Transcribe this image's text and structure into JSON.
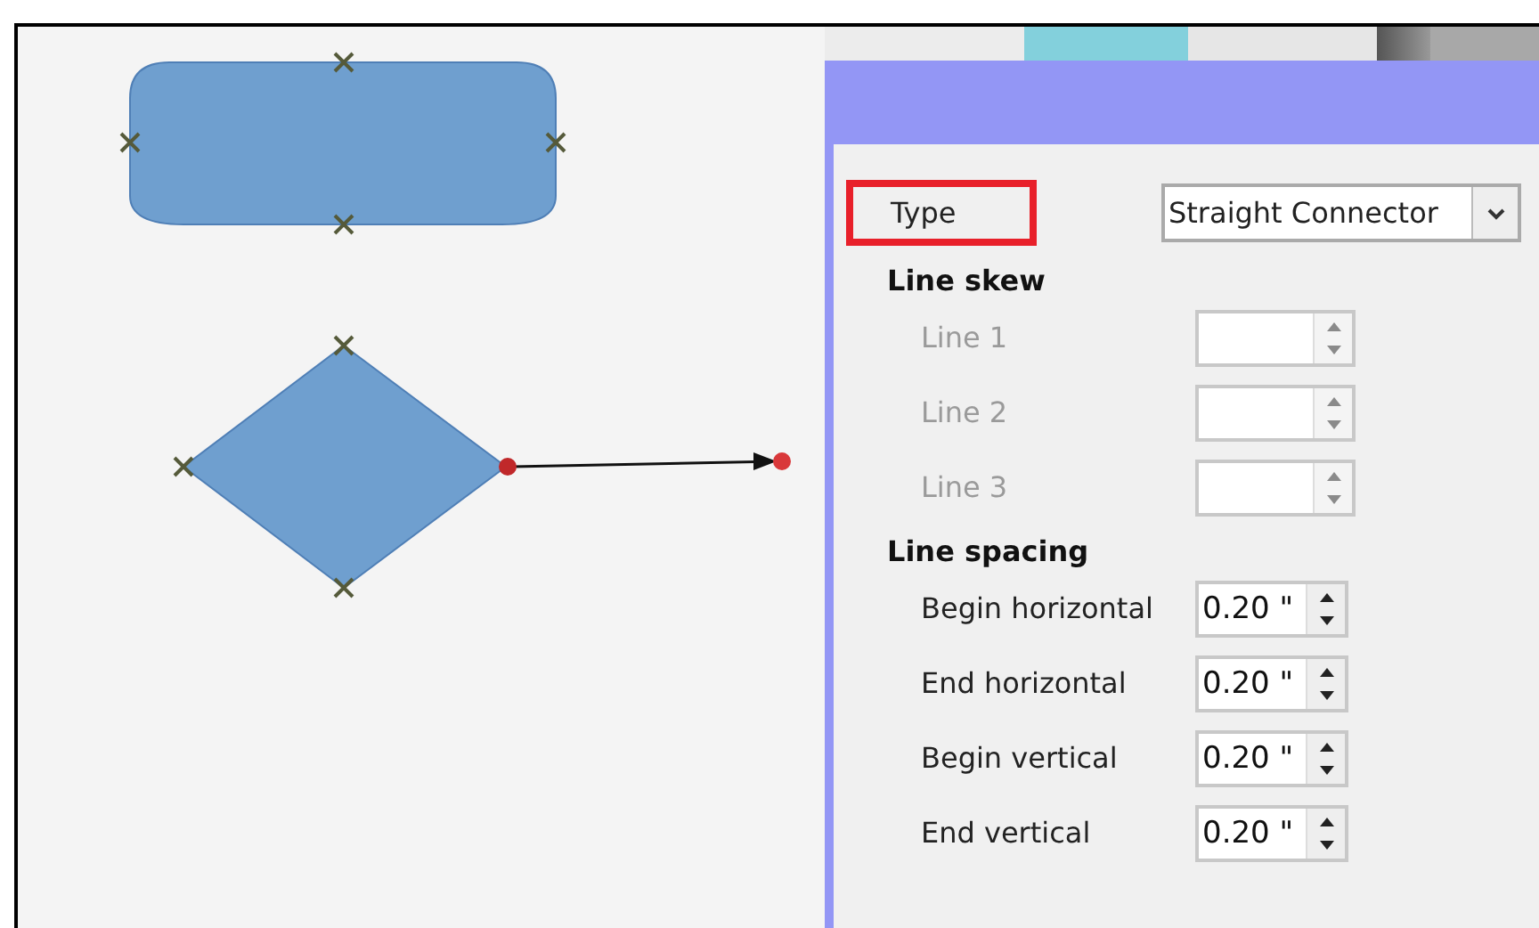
{
  "dialog": {
    "type_field": {
      "label": "Type",
      "highlighted": true,
      "value": "Straight Connector"
    },
    "sections": [
      {
        "title": "Line skew",
        "rows": [
          {
            "label": "Line 1",
            "disabled": true
          },
          {
            "label": "Line 2",
            "disabled": true
          },
          {
            "label": "Line 3",
            "disabled": true
          }
        ]
      },
      {
        "title": "Line spacing",
        "rows": [
          {
            "label": "Begin horizontal",
            "disabled": false,
            "value": "0.20 \""
          },
          {
            "label": "End horizontal",
            "disabled": false,
            "value": "0.20 \""
          },
          {
            "label": "Begin vertical",
            "disabled": false,
            "value": "0.20 \""
          },
          {
            "label": "End vertical",
            "disabled": false,
            "value": "0.20 \""
          }
        ]
      }
    ]
  }
}
